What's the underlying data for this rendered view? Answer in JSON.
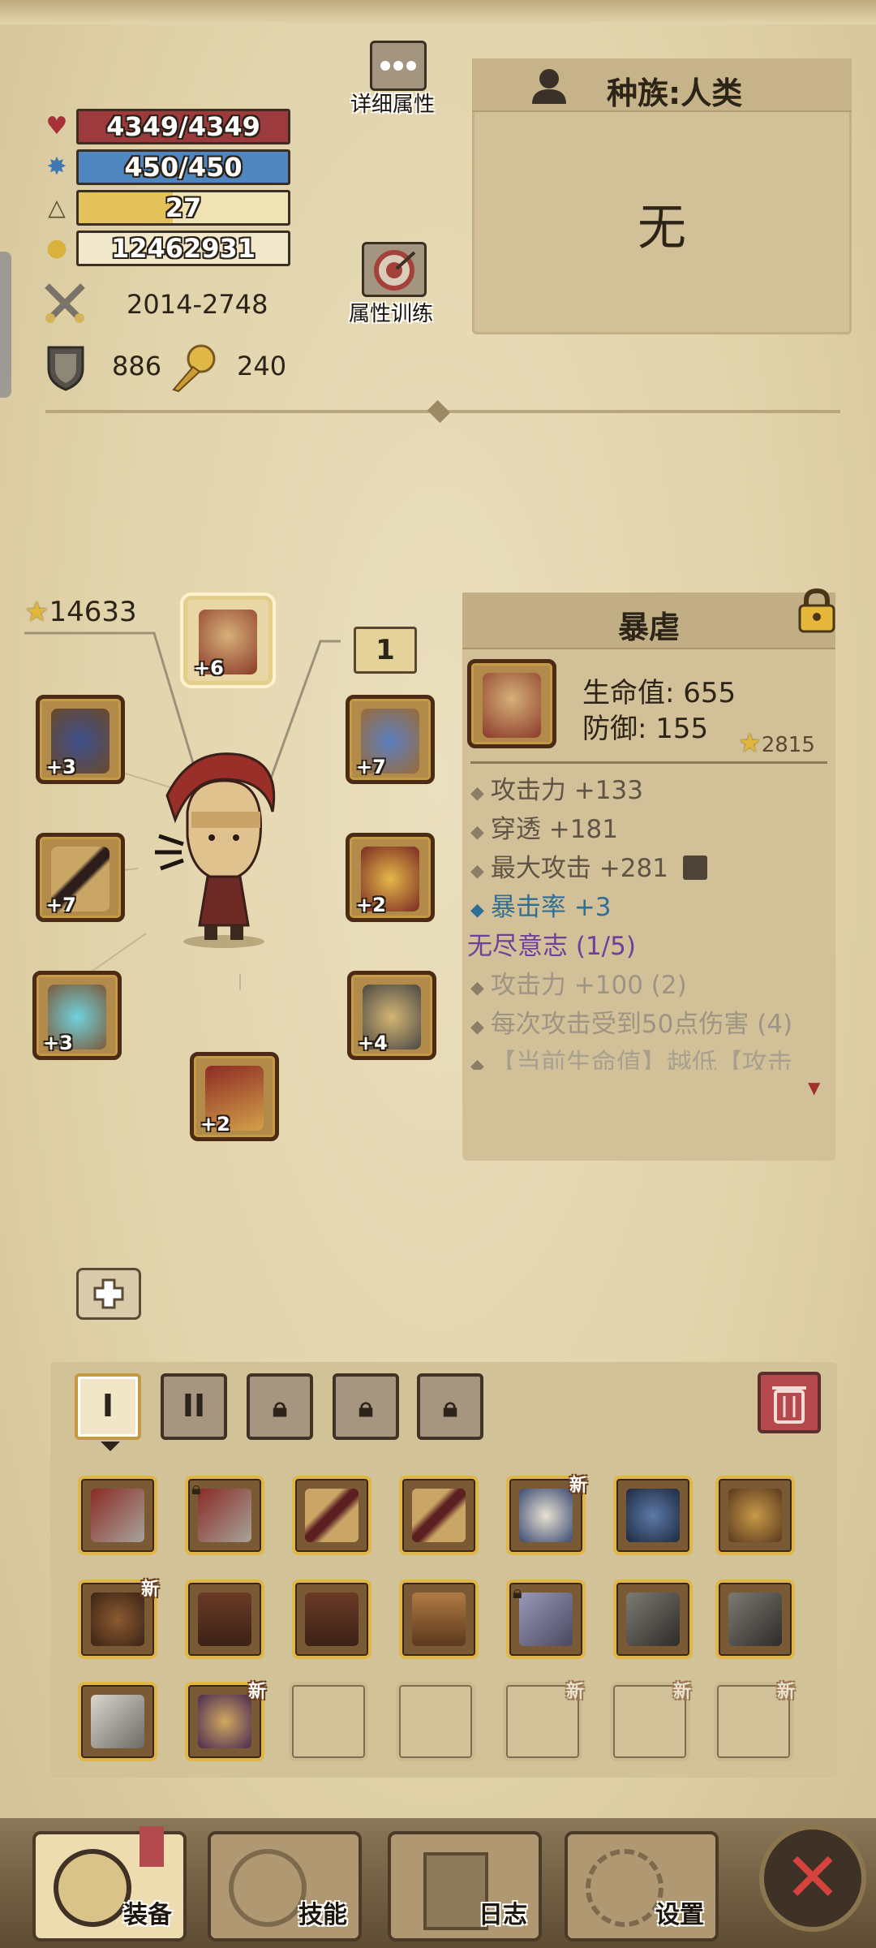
{
  "stats": {
    "hp": "4349/4349",
    "mp": "450/450",
    "level": "27",
    "level_progress": 0.45,
    "gold": "12462931",
    "attack": "2014-2748",
    "defense": "886",
    "magic": "240"
  },
  "buttons": {
    "detail_attributes": "详细属性",
    "attribute_training": "属性训练"
  },
  "race": {
    "title": "种族:人类",
    "value": "无"
  },
  "equipment": {
    "power_score": "14633",
    "set_number": "1",
    "slots": {
      "helmet_plus": "+6",
      "amulet_plus": "+3",
      "necklace_plus": "+7",
      "weapon_plus": "+7",
      "shoulder_plus": "+2",
      "bracer_plus": "+3",
      "armor_plus": "+4",
      "boots_plus": "+2"
    }
  },
  "detail": {
    "title": "暴虐",
    "hp": "生命值: 655",
    "defense": "防御: 155",
    "score": "2815",
    "lines": [
      "攻击力 +133",
      "穿透 +181",
      "最大攻击 +281",
      "暴击率 +3",
      "无尽意志 (1/5)",
      "攻击力 +100 (2)",
      "每次攻击受到50点伤害 (4)",
      "【当前生命值】越低【攻击"
    ]
  },
  "inventory": {
    "tabs": [
      "I",
      "II"
    ],
    "new_label": "新"
  },
  "nav": {
    "equipment": "装备",
    "skills": "技能",
    "log": "日志",
    "settings": "设置"
  },
  "colors": {
    "hp": "#9d3a3e",
    "mp": "#4f86bf",
    "xp": "#e4c259",
    "accent_gold": "#e0b64b",
    "close_red": "#d6433e"
  }
}
